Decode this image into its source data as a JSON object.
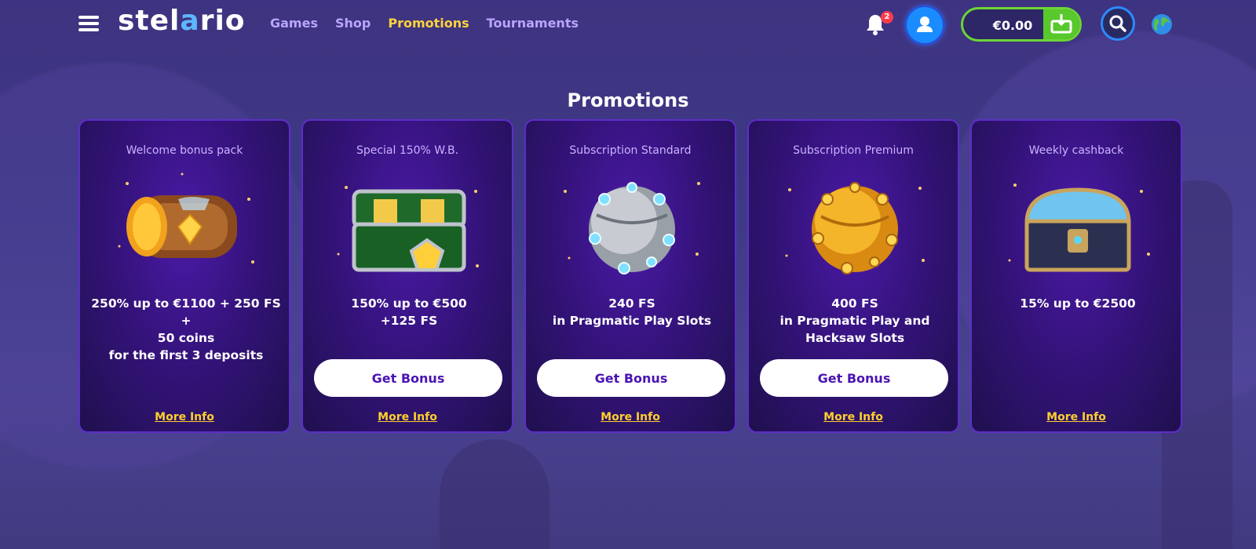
{
  "header": {
    "logo_pre": "stel",
    "logo_accent": "a",
    "logo_post": "rio",
    "nav": [
      "Games",
      "Shop",
      "Promotions",
      "Tournaments"
    ],
    "active_nav": "Promotions",
    "notification_count": "2",
    "balance": "€0.00",
    "icons": [
      "menu-icon",
      "bell-icon",
      "user-icon",
      "deposit-icon",
      "search-icon",
      "globe-icon"
    ]
  },
  "page": {
    "title": "Promotions"
  },
  "promotions": [
    {
      "subtitle": "Welcome bonus pack",
      "lines": [
        "250% up to €1100 + 250 FS +",
        "50 coins",
        "for the first 3 deposits"
      ],
      "button": "",
      "more": "More Info",
      "art": "bronze-chest-icon"
    },
    {
      "subtitle": "Special 150% W.B.",
      "lines": [
        "150% up to €500",
        "+125 FS"
      ],
      "button": "Get Bonus",
      "more": "More Info",
      "art": "green-chest-icon"
    },
    {
      "subtitle": "Subscription Standard",
      "lines": [
        "240 FS",
        "in Pragmatic Play Slots"
      ],
      "button": "Get Bonus",
      "more": "More Info",
      "art": "silver-orb-icon"
    },
    {
      "subtitle": "Subscription Premium",
      "lines": [
        "400 FS",
        "in Pragmatic Play and",
        "Hacksaw Slots"
      ],
      "button": "Get Bonus",
      "more": "More Info",
      "art": "gold-orb-icon"
    },
    {
      "subtitle": "Weekly cashback",
      "lines": [
        "15% up to €2500"
      ],
      "button": "",
      "more": "More Info",
      "art": "blue-chest-icon"
    }
  ],
  "colors": {
    "background": "#3e3380",
    "nav_link": "#b9a6ff",
    "nav_active": "#ffd23c",
    "card_border": "#5e2dc9",
    "button_text": "#4a14b3",
    "more_info": "#ffcf2e",
    "wallet_border": "#6cd634"
  }
}
